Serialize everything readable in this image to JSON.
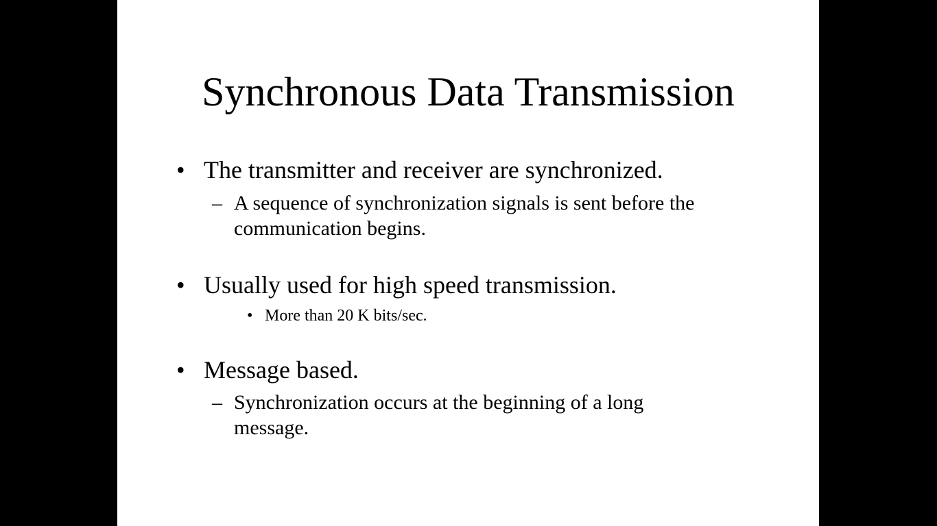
{
  "slide": {
    "title": "Synchronous Data Transmission",
    "bullets": [
      {
        "marker": "•",
        "text": "The transmitter and receiver are synchronized.",
        "sub": {
          "marker": "–",
          "line1": "A sequence of synchronization signals is sent before the",
          "line2": "communication begins."
        }
      },
      {
        "marker": "•",
        "text": "Usually used for high speed transmission.",
        "sub": {
          "marker": "•",
          "line1": "More than 20 K bits/sec."
        }
      },
      {
        "marker": "•",
        "text": "Message based.",
        "sub": {
          "marker": "–",
          "line1": "Synchronization occurs at the beginning of a long",
          "line2": "message."
        }
      }
    ]
  }
}
